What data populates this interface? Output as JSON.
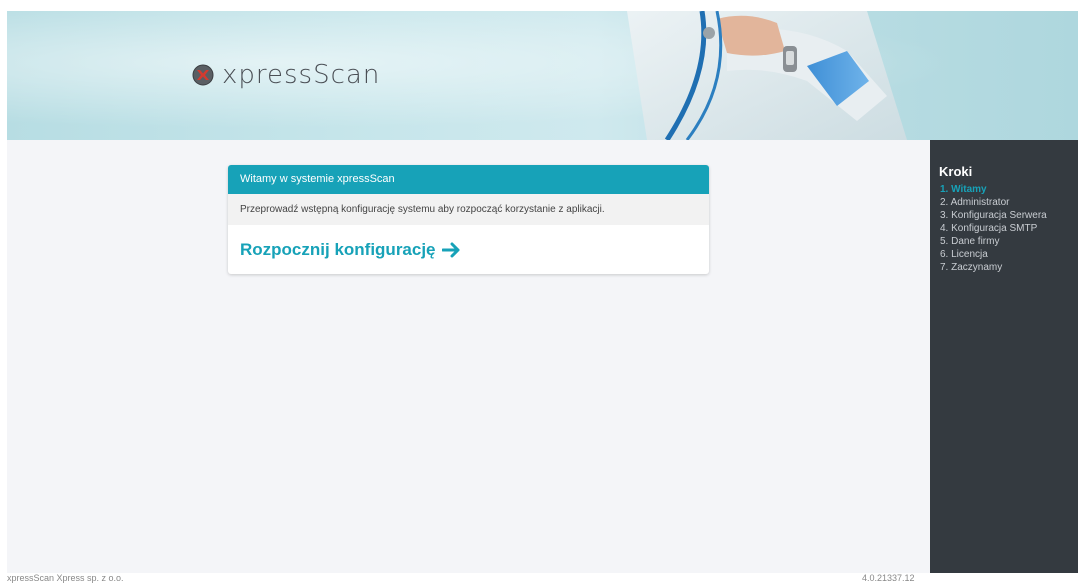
{
  "header": {
    "logo_text": "xpressScan",
    "logo_icon": "xpressscan-logo-icon",
    "banner_image": "doctor-with-stethoscope"
  },
  "card": {
    "title": "Witamy w systemie xpressScan",
    "description": "Przeprowadź wstępną konfigurację systemu aby rozpocząć korzystanie z aplikacji.",
    "action_label": "Rozpocznij konfigurację",
    "action_icon": "arrow-right-icon"
  },
  "sidebar": {
    "title": "Kroki",
    "steps": [
      {
        "label": "1. Witamy",
        "active": true
      },
      {
        "label": "2. Administrator",
        "active": false
      },
      {
        "label": "3. Konfiguracja Serwera",
        "active": false
      },
      {
        "label": "4. Konfiguracja SMTP",
        "active": false
      },
      {
        "label": "5. Dane firmy",
        "active": false
      },
      {
        "label": "6. Licencja",
        "active": false
      },
      {
        "label": "7. Zaczynamy",
        "active": false
      }
    ]
  },
  "footer": {
    "company": "xpressScan Xpress sp. z o.o.",
    "version": "4.0.21337.12"
  },
  "colors": {
    "accent": "#17a2b8",
    "sidebar_bg": "#343a40",
    "content_bg": "#f4f5f8"
  }
}
